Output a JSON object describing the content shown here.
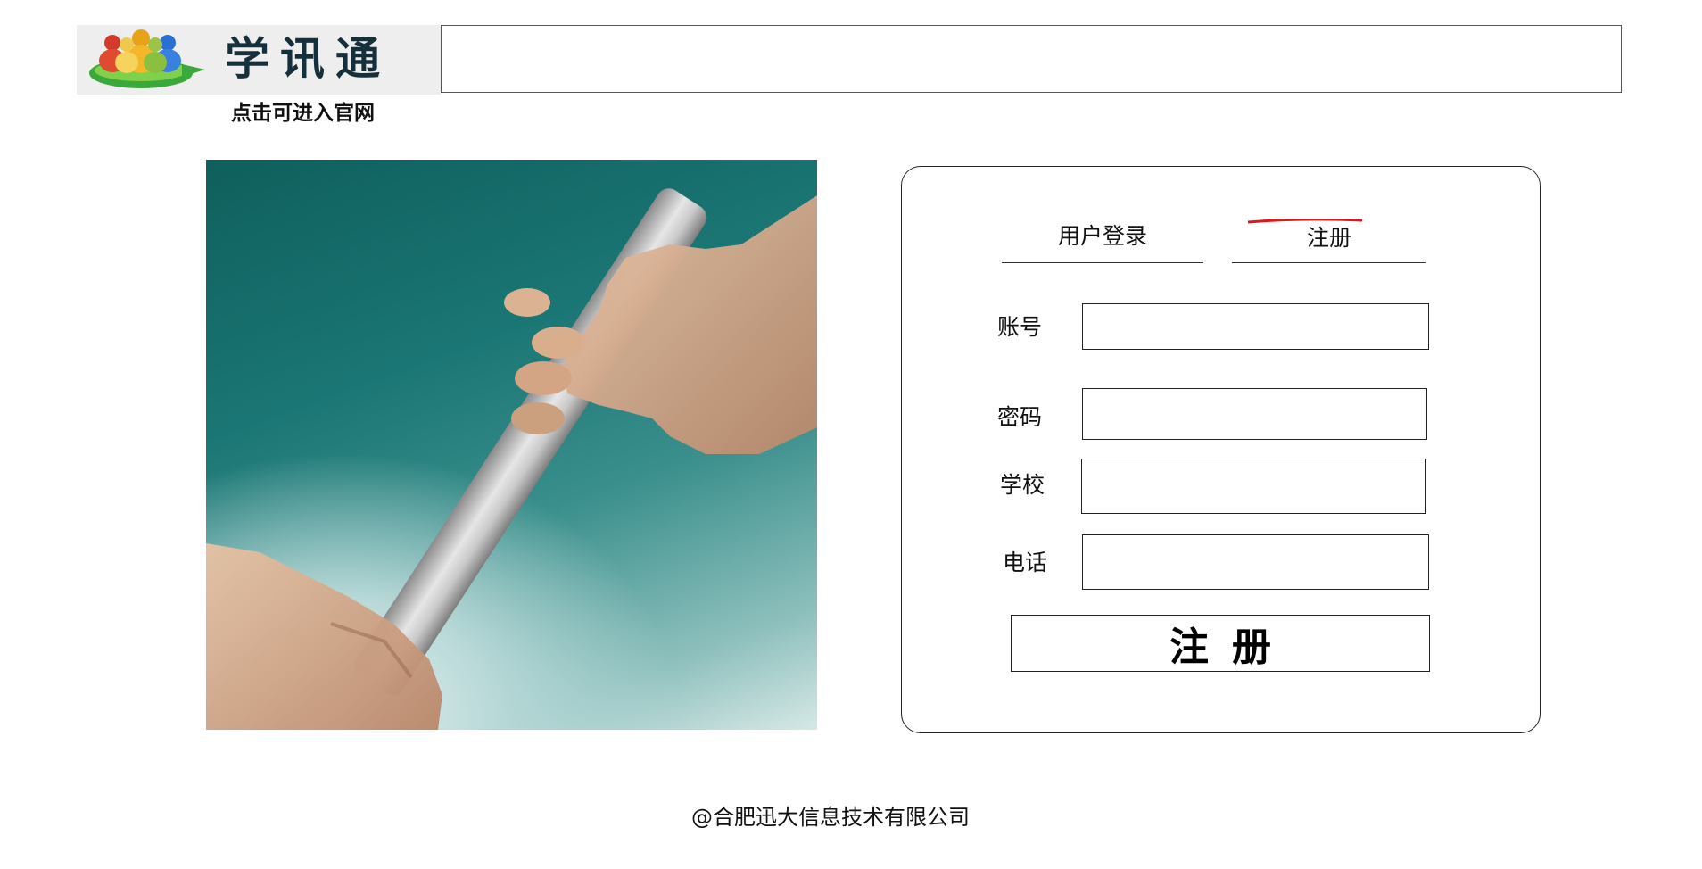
{
  "header": {
    "logo_text": "学讯通",
    "logo_caption": "点击可进入官网"
  },
  "form": {
    "tabs": {
      "login_label": "用户登录",
      "register_label": "注册",
      "active": "register",
      "active_marker_color": "#e4141b"
    },
    "fields": [
      {
        "label": "账号",
        "value": ""
      },
      {
        "label": "密码",
        "value": ""
      },
      {
        "label": "学校",
        "value": ""
      },
      {
        "label": "电话",
        "value": ""
      }
    ],
    "submit_label": "注册"
  },
  "footer": {
    "copyright": "@合肥迅大信息技术有限公司"
  }
}
